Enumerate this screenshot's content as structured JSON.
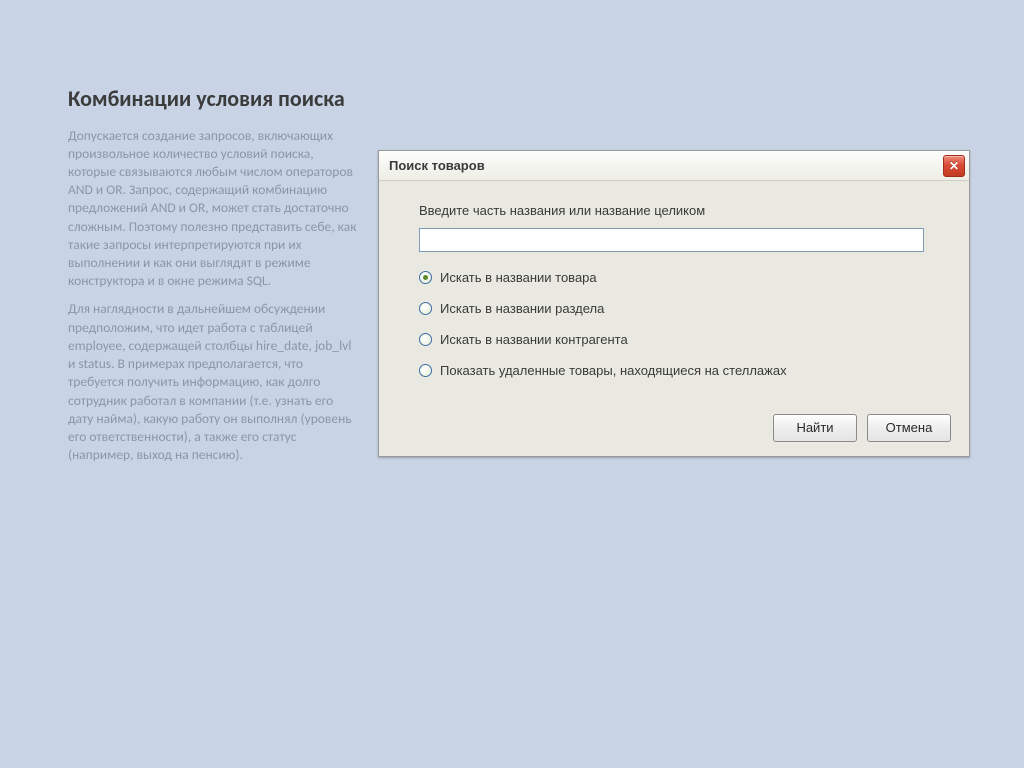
{
  "heading": "Комбинации условия поиска",
  "para1": "Допускается создание запросов, включающих произвольное количество условий поиска, которые связываются любым числом операторов AND и OR. Запрос, содержащий комбинацию предложений AND и OR, может стать достаточно сложным. Поэтому полезно представить себе, как такие запросы интерпретируются при их выполнении и как они выглядят в режиме конструктора и в окне режима SQL.",
  "para2": "Для наглядности в дальнейшем обсуждении предположим, что идет работа с таблицей employee, содержащей столбцы hire_date, job_lvl и status. В примерах предполагается, что требуется получить информацию, как долго сотрудник работал в компании (т.е. узнать его дату найма), какую работу он выполнял (уровень его ответственности), а также его статус (например, выход на пенсию).",
  "dialog": {
    "title": "Поиск товаров",
    "prompt": "Введите часть названия или название целиком",
    "input_value": "",
    "radios": [
      {
        "label": "Искать в названии товара",
        "checked": true
      },
      {
        "label": "Искать в названии раздела",
        "checked": false
      },
      {
        "label": "Искать в названии контрагента",
        "checked": false
      },
      {
        "label": "Показать удаленные товары, находящиеся на стеллажах",
        "checked": false
      }
    ],
    "find_label": "Найти",
    "cancel_label": "Отмена"
  }
}
